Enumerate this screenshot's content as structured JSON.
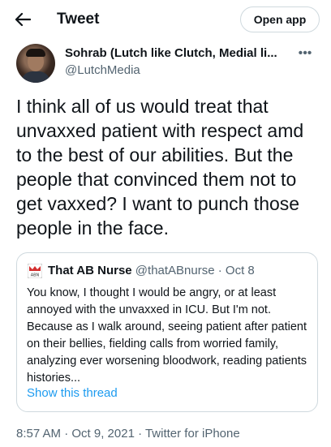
{
  "header": {
    "title": "Tweet",
    "open_app_label": "Open app"
  },
  "author": {
    "name": "Sohrab (Lutch like Clutch, Medial li...",
    "handle": "@LutchMedia"
  },
  "tweet": {
    "text": "I think all of us would treat that unvaxxed patient with respect amd to the best of our abilities. But the people that convinced them not to get vaxxed? I want to punch those people  in the face."
  },
  "quoted_tweet": {
    "name": "That AB Nurse",
    "handle": "@thatABnurse",
    "separator": " · ",
    "date": "Oct 8",
    "avatar_text": "ABN",
    "text": "You know, I thought I would be angry, or at least annoyed with the unvaxxed in ICU. But I'm not. Because as I walk around, seeing patient after patient on their bellies, fielding calls from worried family, analyzing ever worsening bloodwork, reading patients histories...",
    "show_thread_label": "Show this thread"
  },
  "timestamp": "8:57 AM · Oct 9, 2021 · Twitter for iPhone",
  "colors": {
    "link": "#1d9bf0",
    "secondary_text": "#536471",
    "border": "#cfd9de"
  },
  "icons": {
    "back": "arrow-left-icon",
    "more": "more-dots-icon"
  }
}
